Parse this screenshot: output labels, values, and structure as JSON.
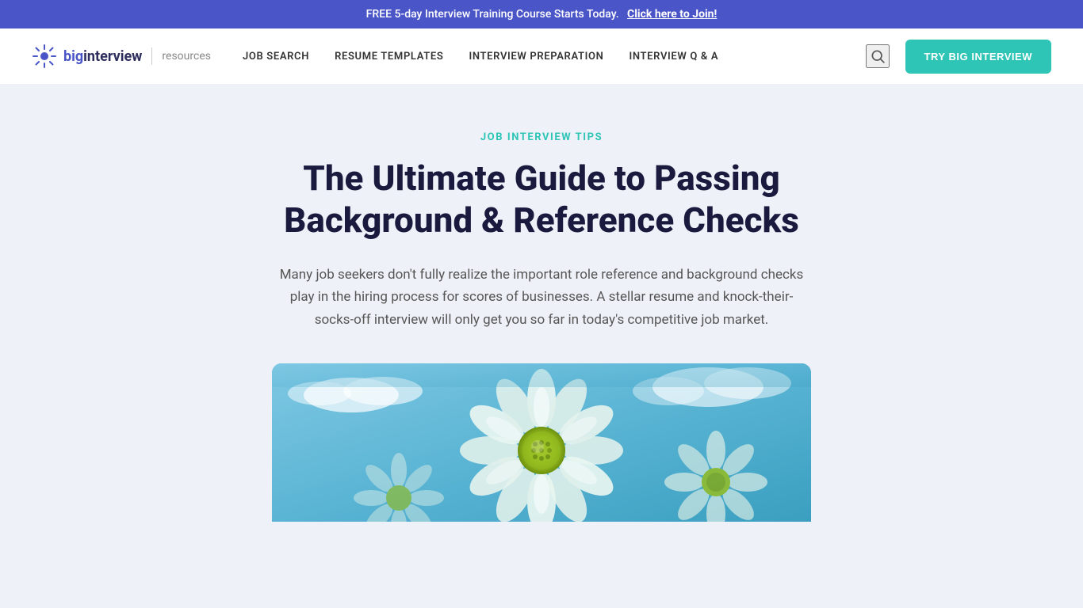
{
  "banner": {
    "text": "FREE 5-day Interview Training Course Starts Today.",
    "link_text": "Click here to Join!"
  },
  "header": {
    "logo": {
      "big": "big",
      "interview": "interview",
      "divider": "|",
      "resources": "resources"
    },
    "nav_items": [
      {
        "label": "JOB SEARCH",
        "id": "job-search"
      },
      {
        "label": "RESUME TEMPLATES",
        "id": "resume-templates"
      },
      {
        "label": "INTERVIEW PREPARATION",
        "id": "interview-preparation"
      },
      {
        "label": "INTERVIEW Q & A",
        "id": "interview-qa"
      }
    ],
    "cta_button": "TRY BIG INTERVIEW"
  },
  "article": {
    "category": "JOB INTERVIEW TIPS",
    "title": "The Ultimate Guide to Passing Background & Reference Checks",
    "intro": "Many job seekers don't fully realize the important role reference and background checks play in the hiring process for scores of businesses. A stellar resume and knock-their-socks-off interview will only get you so far in today's competitive job market."
  },
  "colors": {
    "banner_bg": "#4a55c8",
    "accent": "#2ec4b6",
    "logo_accent": "#4a55c8",
    "logo_dark": "#2d2d5e",
    "title_color": "#1a1a3e",
    "body_bg": "#eef2f8"
  }
}
